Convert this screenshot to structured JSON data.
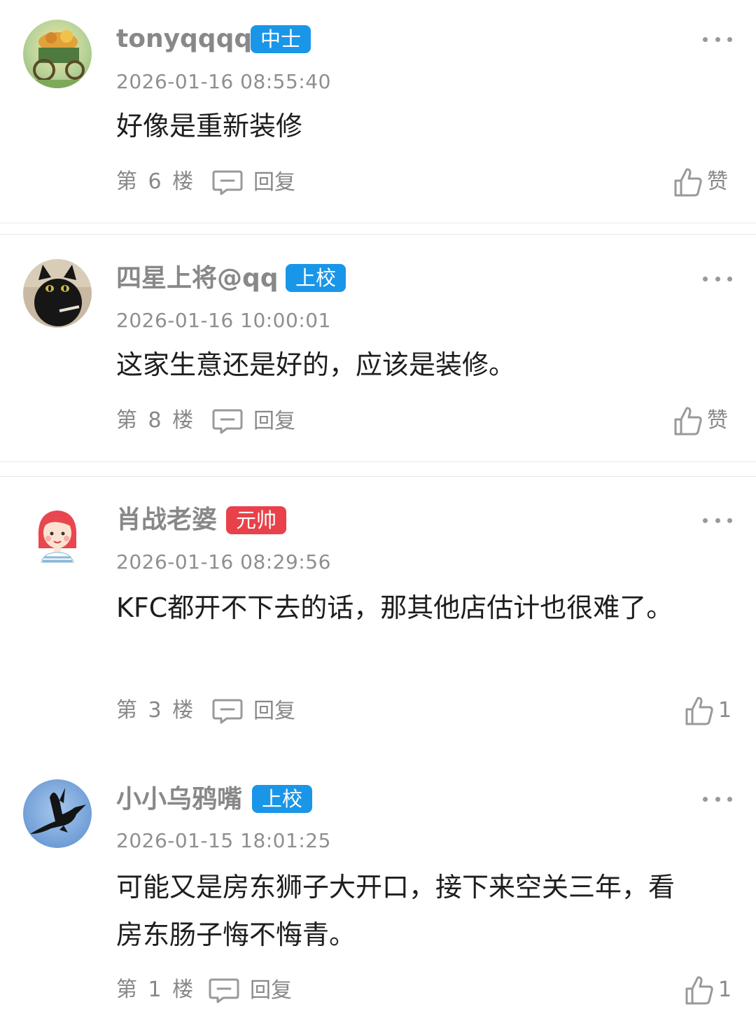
{
  "comments": [
    {
      "username": "tonyqqqq",
      "badge": "中士",
      "badge_color": "#1a96e8",
      "timestamp": "2026-01-16 08:55:40",
      "text": "好像是重新装修",
      "floor": "第 6 楼",
      "reply_label": "回复",
      "like_label": "赞",
      "avatar": "cart-avatar"
    },
    {
      "username": "四星上将@qq",
      "badge": "上校",
      "badge_color": "#1a96e8",
      "timestamp": "2026-01-16 10:00:01",
      "text": "这家生意还是好的，应该是装修。",
      "floor": "第 8 楼",
      "reply_label": "回复",
      "like_label": "赞",
      "avatar": "black-cat-avatar"
    },
    {
      "username": "肖战老婆",
      "badge": "元帅",
      "badge_color": "#e8414a",
      "timestamp": "2026-01-16 08:29:56",
      "text": "KFC都开不下去的话，那其他店估计也很难了。",
      "floor": "第 3 楼",
      "reply_label": "回复",
      "like_label": "1",
      "avatar": "cartoon-girl-avatar"
    },
    {
      "username": "小小乌鸦嘴",
      "badge": "上校",
      "badge_color": "#1a96e8",
      "timestamp": "2026-01-15 18:01:25",
      "text": "可能又是房东狮子大开口，接下来空关三年，看房东肠子悔不悔青。",
      "floor": "第 1 楼",
      "reply_label": "回复",
      "like_label": "1",
      "avatar": "crow-avatar"
    }
  ],
  "icons": {
    "more": "more-dots-icon",
    "reply": "comment-bubble-icon",
    "like": "thumbs-up-icon"
  }
}
